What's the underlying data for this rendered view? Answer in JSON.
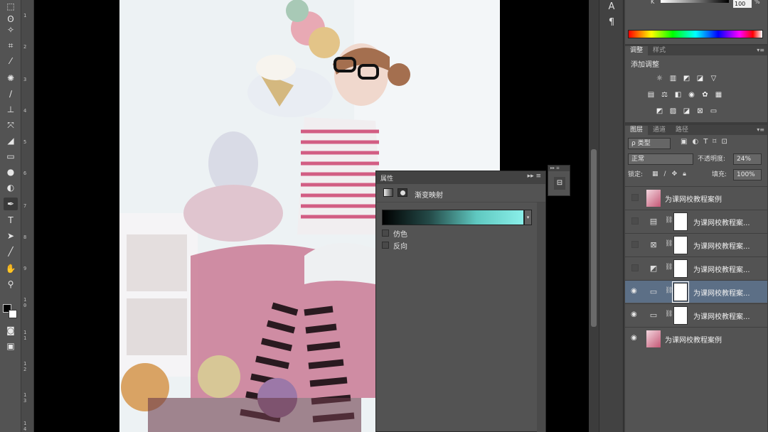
{
  "ruler": {
    "ticks": [
      "1",
      "2",
      "3",
      "4",
      "5",
      "6",
      "7",
      "8",
      "9",
      "1\n0",
      "1\n1",
      "1\n2",
      "1\n3",
      "1\n4"
    ]
  },
  "color_strip": {
    "channel_label": "K",
    "value": "100",
    "unit": "%"
  },
  "mini_col": {
    "glyph_a": "A",
    "glyph_para": "¶"
  },
  "adjustments": {
    "tabs": [
      "调整",
      "样式"
    ],
    "title": "添加调整"
  },
  "layers_panel": {
    "tabs": [
      "图层",
      "通道",
      "路径"
    ],
    "filter_label": "ρ 类型",
    "blend_mode": "正常",
    "opacity_label": "不透明度:",
    "opacity_value": "24%",
    "lock_label": "锁定:",
    "fill_label": "填充:",
    "fill_value": "100%",
    "layers": [
      {
        "name": "为课网校教程案例",
        "visible": false,
        "kind": "photo"
      },
      {
        "name": "为课网校教程案...",
        "visible": false,
        "kind": "adj-levels"
      },
      {
        "name": "为课网校教程案...",
        "visible": false,
        "kind": "adj-hsl"
      },
      {
        "name": "为课网校教程案...",
        "visible": false,
        "kind": "adj-curves"
      },
      {
        "name": "为课网校教程案...",
        "visible": true,
        "kind": "adj-gradient",
        "selected": true
      },
      {
        "name": "为课网校教程案...",
        "visible": true,
        "kind": "adj-gradient"
      },
      {
        "name": "为课网校教程案例",
        "visible": true,
        "kind": "photo"
      }
    ]
  },
  "properties": {
    "title": "属性",
    "subtitle": "渐变映射",
    "dither_label": "仿色",
    "reverse_label": "反向",
    "gradient_colors": [
      "#000000",
      "#244a48",
      "#5fc8c0",
      "#8aefe9"
    ]
  }
}
